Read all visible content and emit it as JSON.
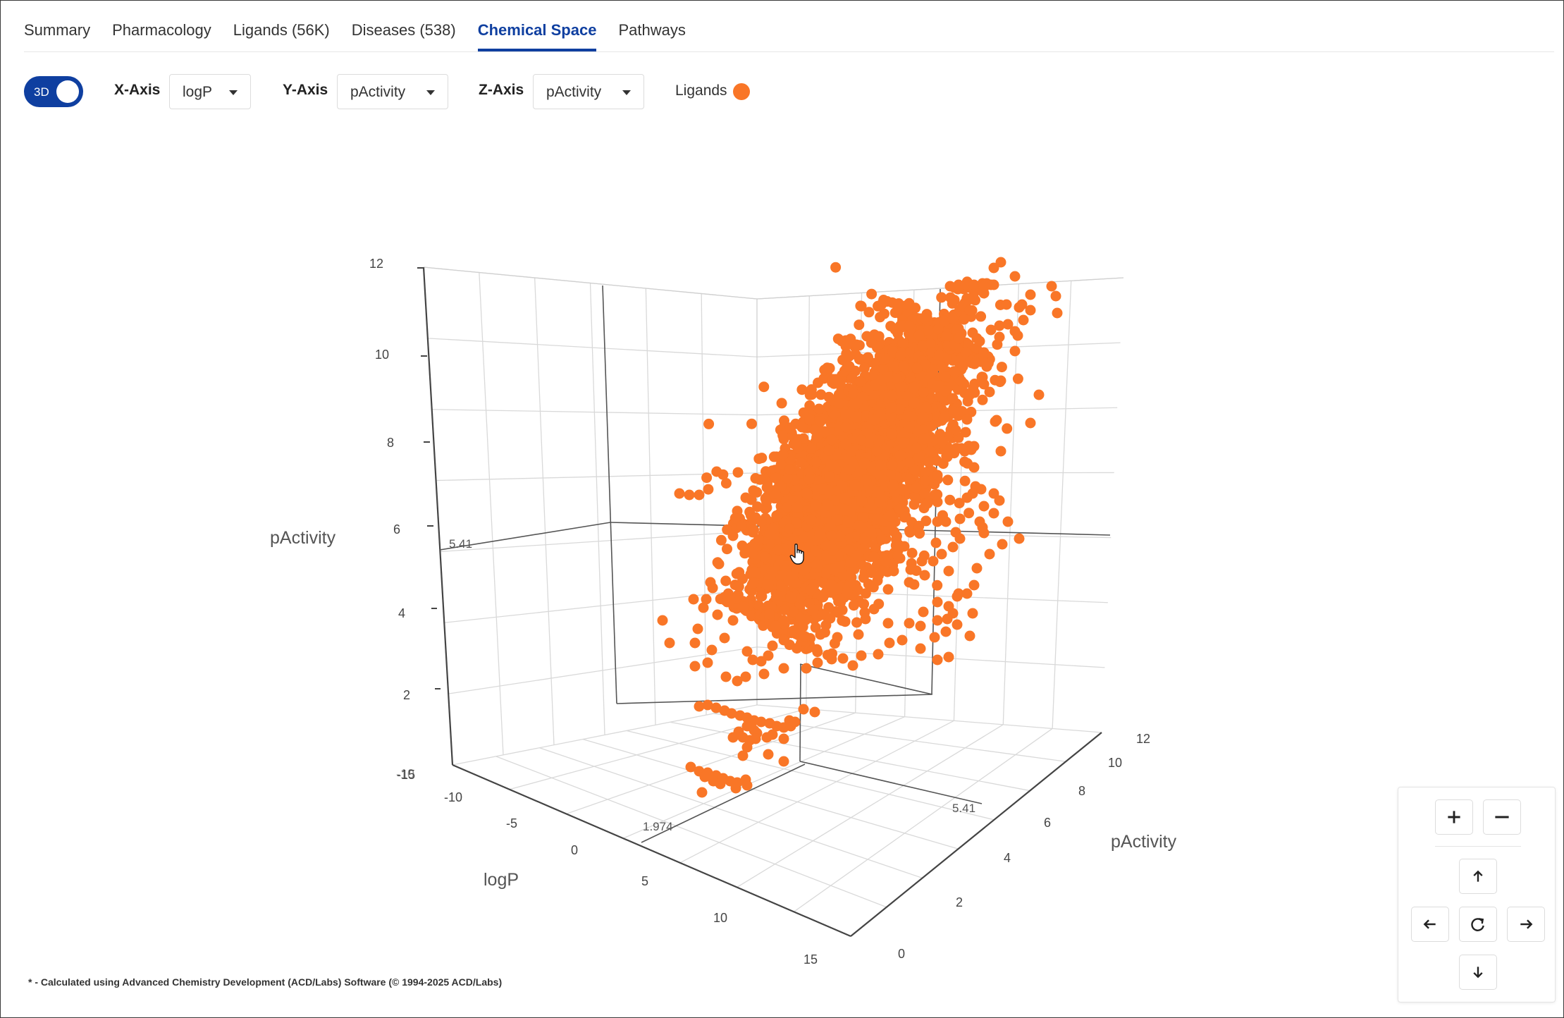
{
  "tabs": [
    {
      "label": "Summary",
      "active": false
    },
    {
      "label": "Pharmacology",
      "active": false
    },
    {
      "label": "Ligands (56K)",
      "active": false
    },
    {
      "label": "Diseases (538)",
      "active": false
    },
    {
      "label": "Chemical Space",
      "active": true
    },
    {
      "label": "Pathways",
      "active": false
    }
  ],
  "controls": {
    "toggle_label": "3D",
    "toggle_on": true,
    "x_axis": {
      "label": "X-Axis",
      "value": "logP"
    },
    "y_axis": {
      "label": "Y-Axis",
      "value": "pActivity"
    },
    "z_axis": {
      "label": "Z-Axis",
      "value": "pActivity"
    },
    "legend_label": "Ligands",
    "legend_color": "#f97627"
  },
  "chart_data": {
    "type": "scatter",
    "series": [
      {
        "name": "Ligands",
        "color": "#f97627"
      }
    ],
    "x_axis": {
      "title": "logP",
      "range": [
        -10,
        15
      ],
      "ticks": [
        "-10",
        "-5",
        "0",
        "5",
        "10",
        "15"
      ],
      "marker": "1.974"
    },
    "y_axis": {
      "title": "pActivity",
      "range": [
        0,
        12
      ],
      "ticks": [
        "0",
        "2",
        "4",
        "6",
        "8",
        "10",
        "12"
      ],
      "marker": "5.41"
    },
    "z_axis": {
      "title": "pActivity",
      "range": [
        0,
        12
      ],
      "ticks": [
        "-15",
        "-10",
        "2",
        "4",
        "6",
        "8",
        "10",
        "12"
      ],
      "marker": "5.41"
    },
    "grid": true
  },
  "footnote": "* - Calculated using Advanced Chemistry Development (ACD/Labs) Software (© 1994-2025 ACD/Labs)",
  "navigation": {
    "zoom_in": "plus-icon",
    "zoom_out": "minus-icon",
    "up": "arrow-up-icon",
    "left": "arrow-left-icon",
    "reset": "rotate-icon",
    "right": "arrow-right-icon",
    "down": "arrow-down-icon"
  }
}
